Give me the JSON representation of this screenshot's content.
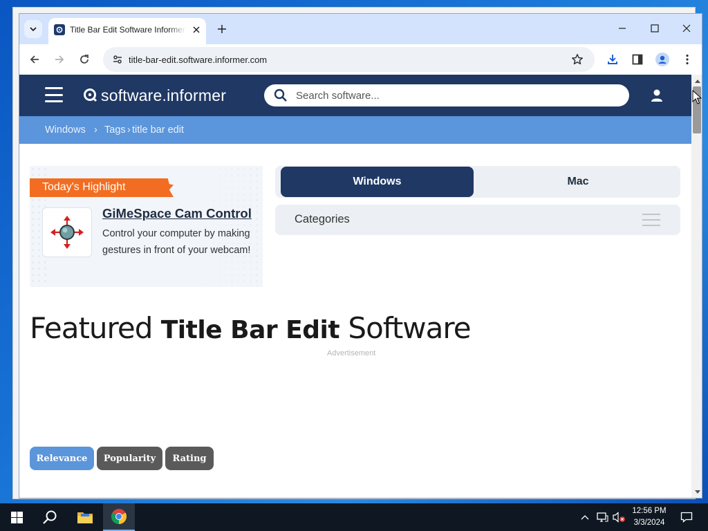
{
  "browser": {
    "tab_title": "Title Bar Edit Software Informer",
    "url": "title-bar-edit.software.informer.com"
  },
  "site": {
    "logo_text": "software.informer",
    "search_placeholder": "Search software...",
    "breadcrumb": {
      "windows": "Windows",
      "separator": "›",
      "tags": "Tags",
      "separator2": "›",
      "current": "title bar edit"
    }
  },
  "highlight": {
    "ribbon": "Today's Highlight",
    "app_name": "GiMeSpace Cam Control",
    "description": "Control your computer by making gestures in front of your webcam!"
  },
  "platform": {
    "windows": "Windows",
    "mac": "Mac"
  },
  "categories_label": "Categories",
  "featured": {
    "prefix": "Featured ",
    "keyword": "Title Bar Edit",
    "suffix": " Software"
  },
  "ad_label": "Advertisement",
  "sort": {
    "relevance": "Relevance",
    "popularity": "Popularity",
    "rating": "Rating"
  },
  "taskbar": {
    "time": "12:56 PM",
    "date": "3/3/2024"
  },
  "colors": {
    "header_navy": "#1f3864",
    "breadcrumb_blue": "#5b95db",
    "ribbon_orange": "#f26d21",
    "sort_active": "#5b95db",
    "sort_inactive": "#5a5a5a"
  }
}
